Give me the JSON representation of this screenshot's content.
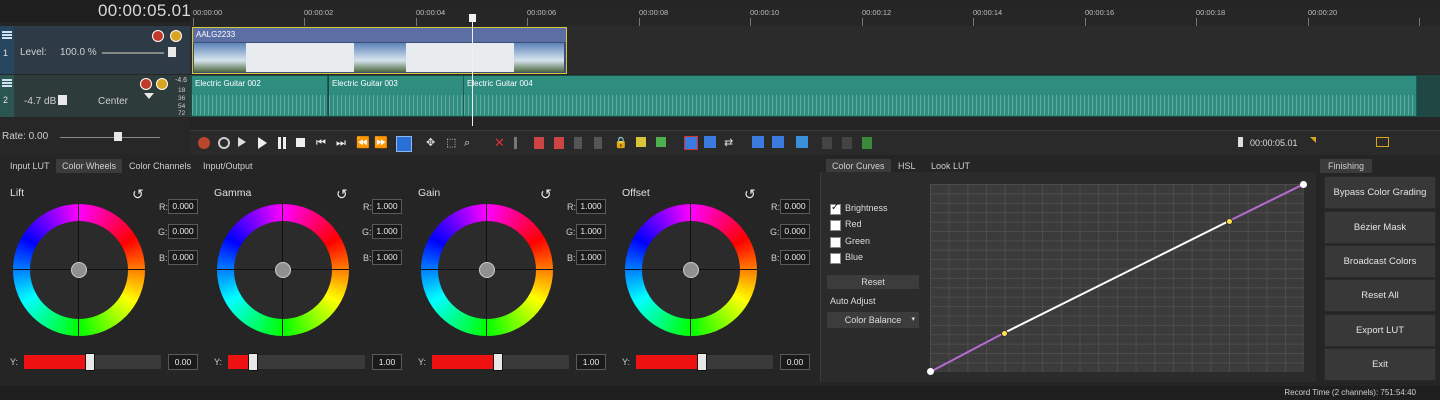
{
  "timeline": {
    "timecode": "00:00:05.01",
    "ruler_labels": [
      "00:00:00",
      "00:00:02",
      "00:00:04",
      "00:00:06",
      "00:00:08",
      "00:00:10",
      "00:00:12",
      "00:00:14",
      "00:00:16",
      "00:00:18",
      "00:00:20"
    ],
    "video_track": {
      "number": "1",
      "level_label": "Level:",
      "level_value": "100.0 %",
      "clip_name": "AALG2233"
    },
    "audio_track": {
      "number": "2",
      "volume": "-4.7 dB",
      "pan": "Center",
      "meter_labels": [
        "-4.6",
        "18",
        "36",
        "54",
        "72"
      ],
      "clips": [
        "Electric Guitar 002",
        "Electric Guitar 003",
        "Electric Guitar 004"
      ]
    },
    "rate_label": "Rate: 0.00",
    "cursor_time": "00:00:05.01"
  },
  "grading": {
    "left_tabs": [
      "Input LUT",
      "Color Wheels",
      "Color Channels",
      "Input/Output"
    ],
    "active_left_tab": "Color Wheels",
    "wheels": [
      {
        "title": "Lift",
        "r": "0.000",
        "g": "0.000",
        "b": "0.000",
        "y": "0.00",
        "y_fraction": 0.48
      },
      {
        "title": "Gamma",
        "r": "1.000",
        "g": "1.000",
        "b": "1.000",
        "y": "1.00",
        "y_fraction": 0.18
      },
      {
        "title": "Gain",
        "r": "1.000",
        "g": "1.000",
        "b": "1.000",
        "y": "1.00",
        "y_fraction": 0.48
      },
      {
        "title": "Offset",
        "r": "0.000",
        "g": "0.000",
        "b": "0.000",
        "y": "0.00",
        "y_fraction": 0.48
      }
    ],
    "rgb_labels": {
      "r": "R:",
      "g": "G:",
      "b": "B:",
      "y": "Y:"
    },
    "curve_tabs": [
      "Color Curves",
      "HSL",
      "Look LUT"
    ],
    "active_curve_tab": "Color Curves",
    "channels": [
      {
        "label": "Brightness",
        "checked": true
      },
      {
        "label": "Red",
        "checked": false
      },
      {
        "label": "Green",
        "checked": false
      },
      {
        "label": "Blue",
        "checked": false
      }
    ],
    "reset_label": "Reset",
    "auto_adjust_label": "Auto Adjust",
    "auto_adjust_value": "Color Balance",
    "finishing_tab": "Finishing",
    "finishing_buttons": [
      "Bypass Color Grading",
      "Bézier Mask",
      "Broadcast Colors",
      "Reset All",
      "Export LUT",
      "Exit"
    ]
  },
  "status": {
    "record_time": "Record Time (2 channels): 751:54:40"
  },
  "colors": {
    "accent_clip_video": "#5c6fa5",
    "accent_clip_audio": "#2f8d80",
    "y_slider": "#ee1111",
    "curve": "#b86ad0"
  }
}
